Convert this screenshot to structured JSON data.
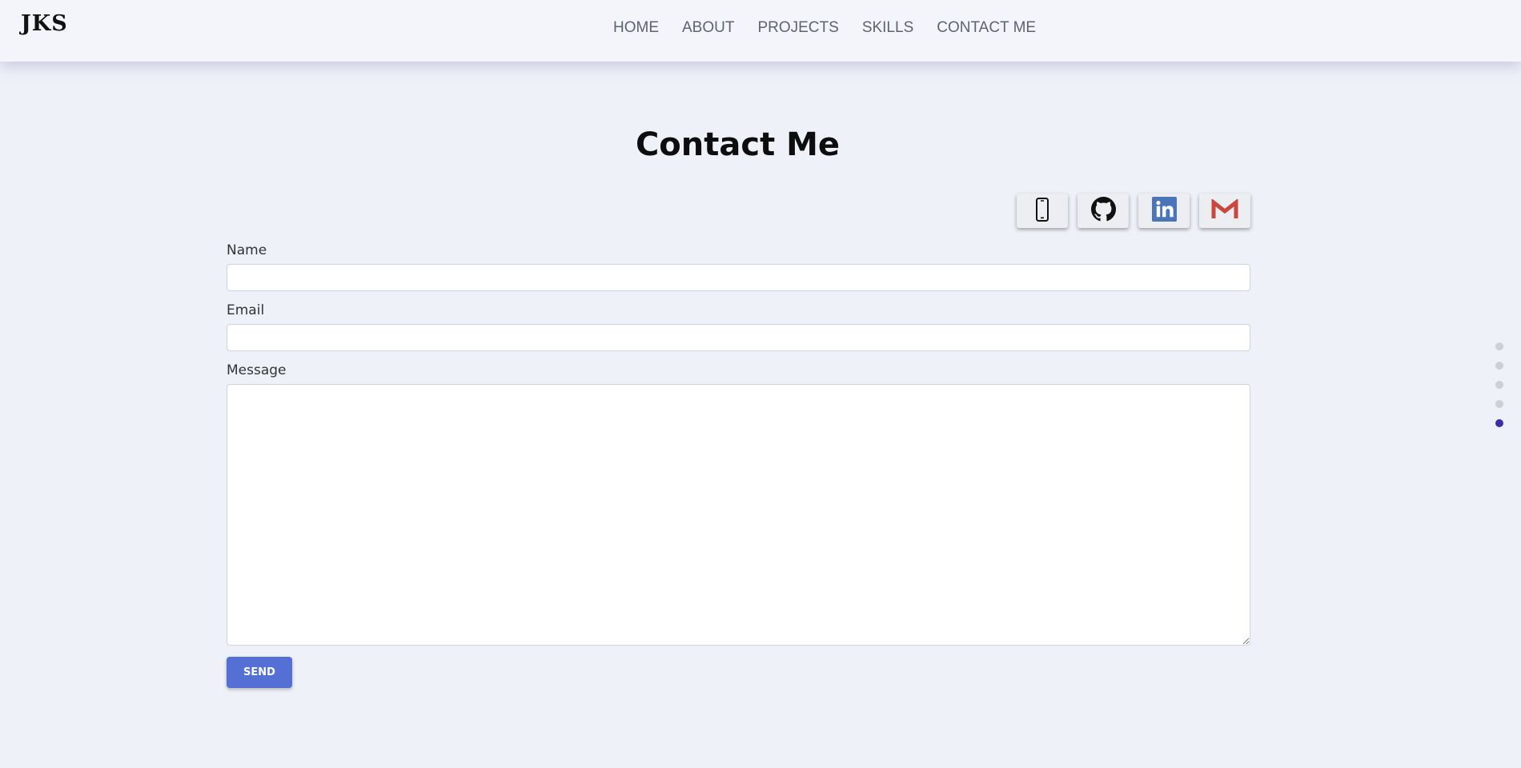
{
  "header": {
    "logo": "JKS",
    "nav": [
      {
        "label": "HOME"
      },
      {
        "label": "ABOUT"
      },
      {
        "label": "PROJECTS"
      },
      {
        "label": "SKILLS"
      },
      {
        "label": "CONTACT ME"
      }
    ]
  },
  "main": {
    "title": "Contact Me",
    "social": [
      {
        "icon": "phone-icon"
      },
      {
        "icon": "github-icon"
      },
      {
        "icon": "linkedin-icon"
      },
      {
        "icon": "gmail-icon"
      }
    ],
    "form": {
      "name_label": "Name",
      "name_value": "",
      "email_label": "Email",
      "email_value": "",
      "message_label": "Message",
      "message_value": "",
      "send_label": "SEND"
    }
  },
  "section_nav": {
    "count": 5,
    "active_index": 4,
    "colors": {
      "active": "#3b2fa8",
      "inactive": "#cfcfd4"
    }
  },
  "colors": {
    "accent": "#5570d4",
    "background": "#eef1f8",
    "linkedin": "#4a76b9",
    "gmail": "#c9473d"
  }
}
